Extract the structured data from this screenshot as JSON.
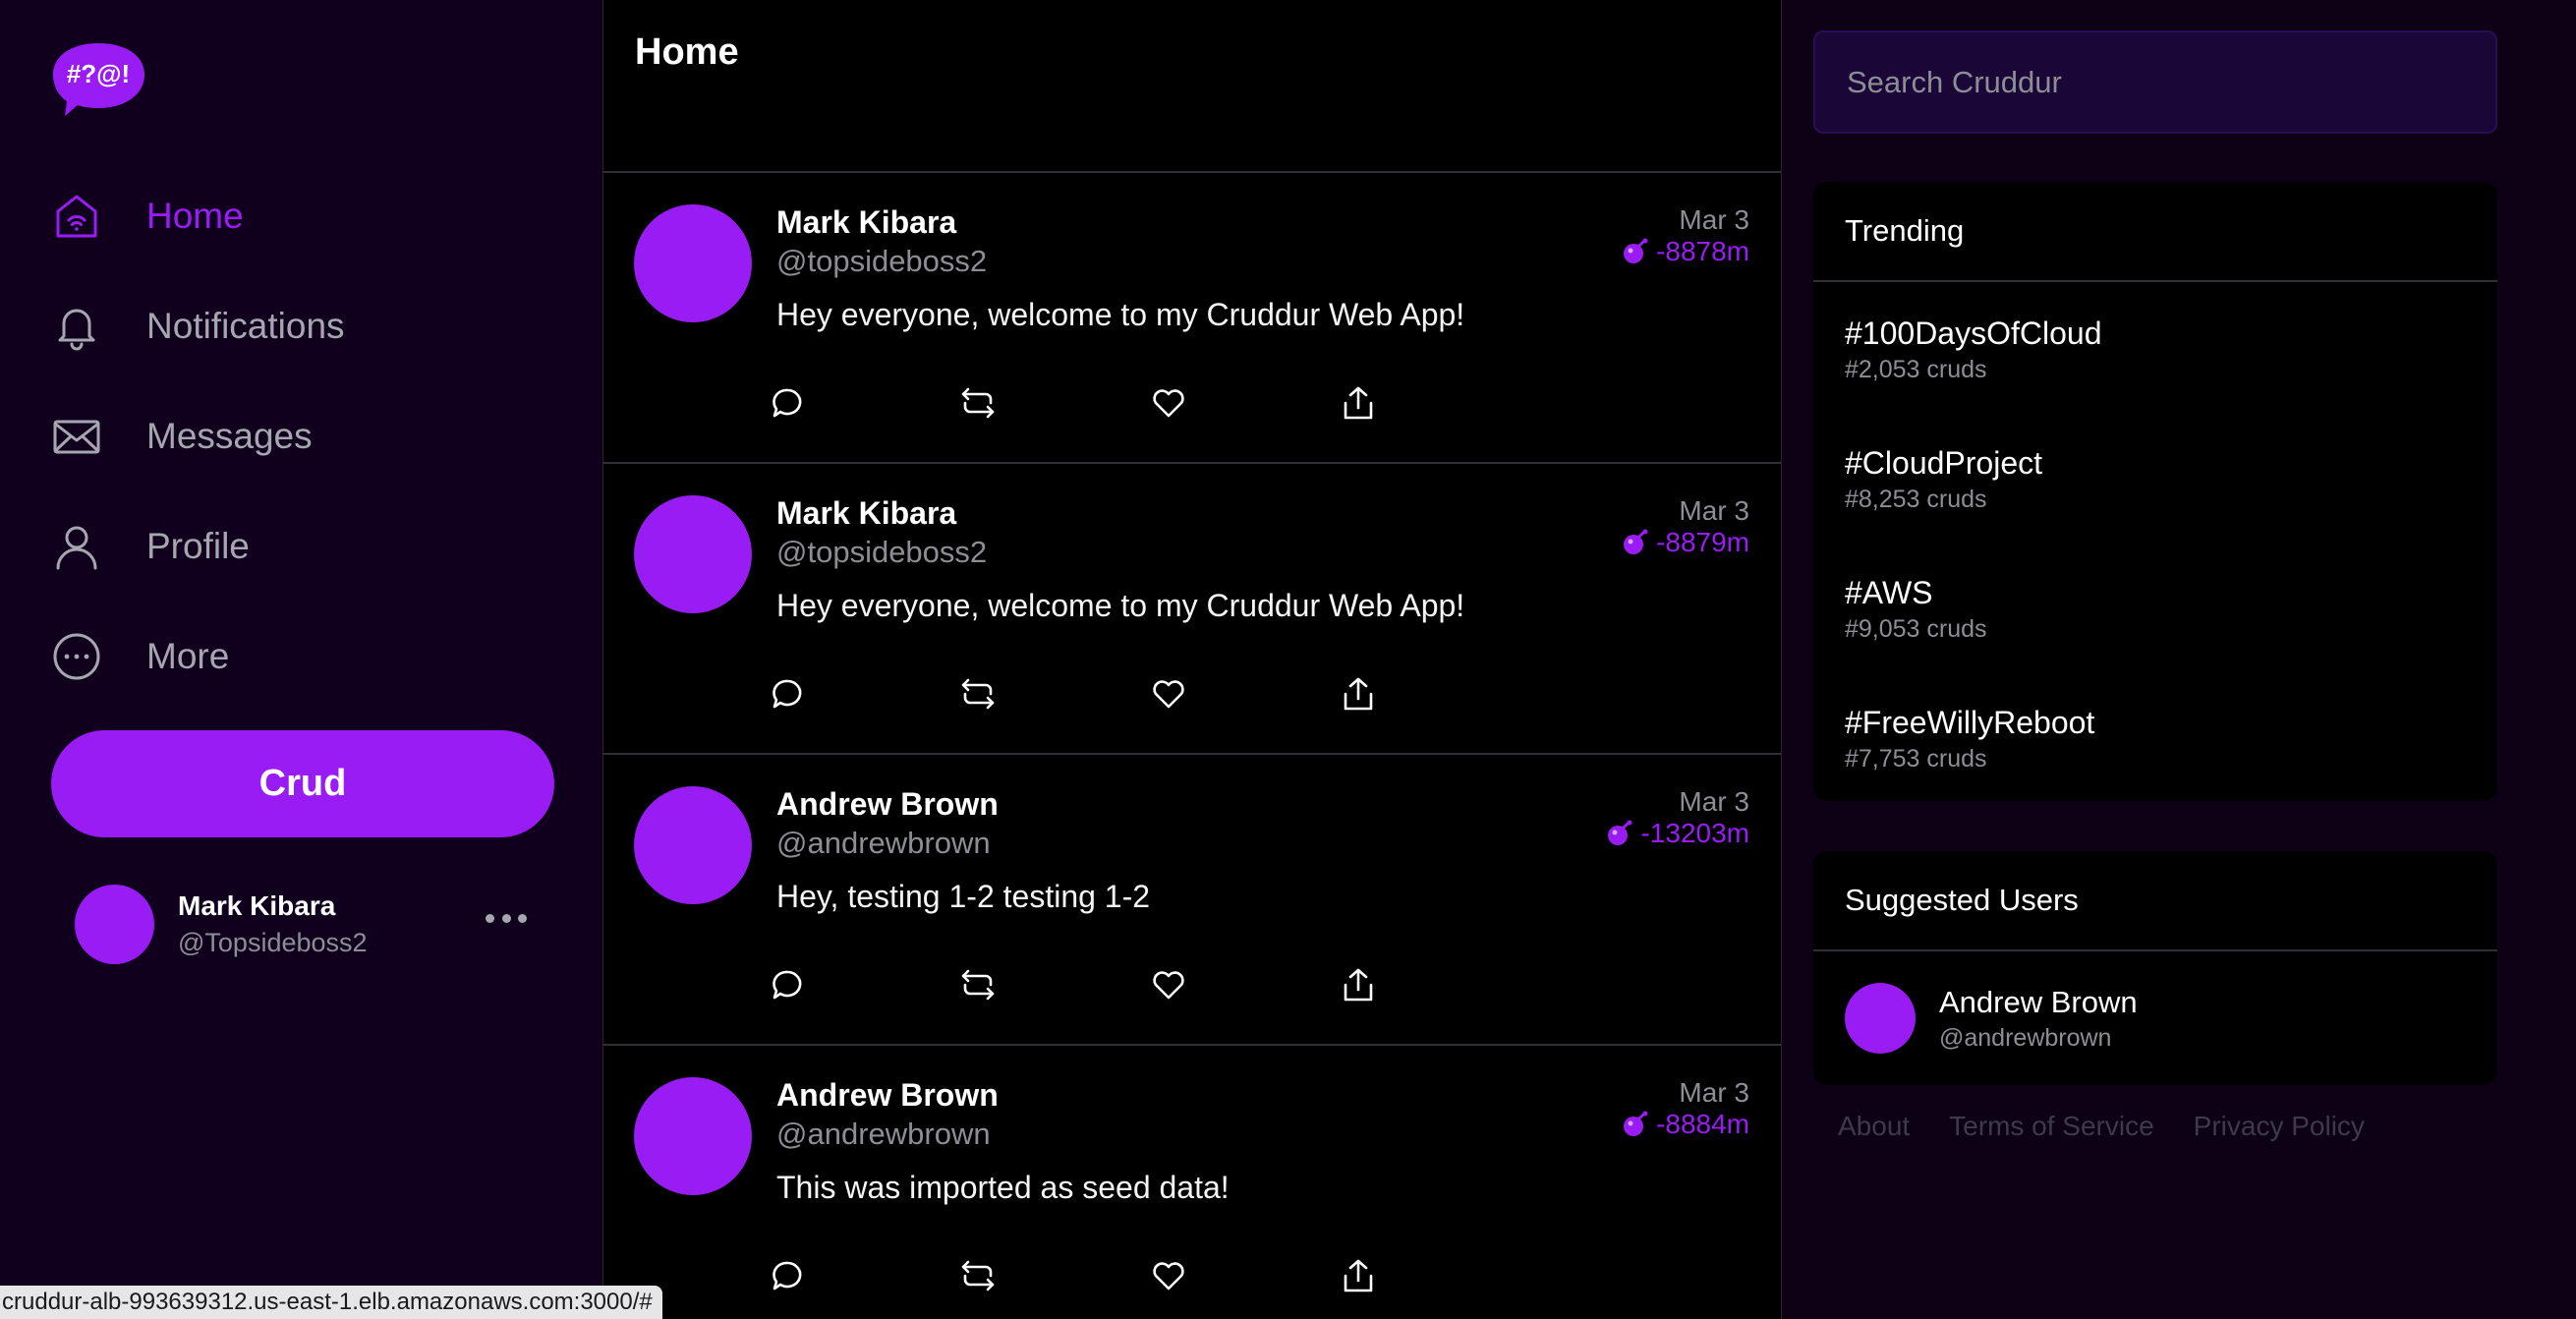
{
  "brand": {
    "logo_text": "#?@!",
    "accent": "#9a1cf5"
  },
  "sidebar": {
    "items": [
      {
        "label": "Home",
        "icon": "home-icon",
        "active": true
      },
      {
        "label": "Notifications",
        "icon": "bell-icon",
        "active": false
      },
      {
        "label": "Messages",
        "icon": "envelope-icon",
        "active": false
      },
      {
        "label": "Profile",
        "icon": "user-icon",
        "active": false
      },
      {
        "label": "More",
        "icon": "more-circle-icon",
        "active": false
      }
    ],
    "crud_button": "Crud",
    "profile": {
      "name": "Mark Kibara",
      "handle": "@Topsideboss2"
    }
  },
  "feed": {
    "title": "Home",
    "posts": [
      {
        "name": "Mark Kibara",
        "handle": "@topsideboss2",
        "date": "Mar 3",
        "expires": "-8878m",
        "text": "Hey everyone, welcome to my Cruddur Web App!"
      },
      {
        "name": "Mark Kibara",
        "handle": "@topsideboss2",
        "date": "Mar 3",
        "expires": "-8879m",
        "text": "Hey everyone, welcome to my Cruddur Web App!"
      },
      {
        "name": "Andrew Brown",
        "handle": "@andrewbrown",
        "date": "Mar 3",
        "expires": "-13203m",
        "text": "Hey, testing 1-2 testing 1-2"
      },
      {
        "name": "Andrew Brown",
        "handle": "@andrewbrown",
        "date": "Mar 3",
        "expires": "-8884m",
        "text": "This was imported as seed data!"
      }
    ]
  },
  "search": {
    "placeholder": "Search Cruddur"
  },
  "trending": {
    "title": "Trending",
    "items": [
      {
        "tag": "#100DaysOfCloud",
        "count": "#2,053 cruds"
      },
      {
        "tag": "#CloudProject",
        "count": "#8,253 cruds"
      },
      {
        "tag": "#AWS",
        "count": "#9,053 cruds"
      },
      {
        "tag": "#FreeWillyReboot",
        "count": "#7,753 cruds"
      }
    ]
  },
  "suggested": {
    "title": "Suggested Users",
    "users": [
      {
        "name": "Andrew Brown",
        "handle": "@andrewbrown"
      }
    ]
  },
  "footer": {
    "about": "About",
    "terms": "Terms of Service",
    "privacy": "Privacy Policy"
  },
  "status_bar": {
    "url": "cruddur-alb-993639312.us-east-1.elb.amazonaws.com:3000/#"
  }
}
